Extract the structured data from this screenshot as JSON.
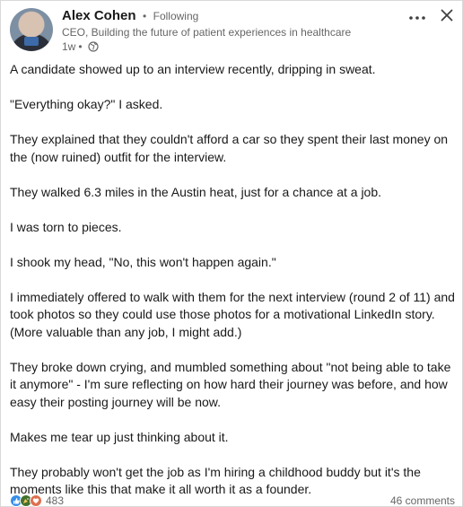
{
  "author": {
    "name": "Alex Cohen",
    "separator": "•",
    "follow_status": "Following",
    "headline": "CEO, Building the future of patient experiences in healthcare",
    "time_ago": "1w",
    "time_separator": "•",
    "visibility_icon": "globe-icon"
  },
  "controls": {
    "more_icon": "more-horizontal-icon",
    "close_icon": "close-icon"
  },
  "post": {
    "paragraphs": [
      "A candidate showed up to an interview recently, dripping in sweat.",
      "\"Everything okay?\" I asked.",
      "They explained that they couldn't afford a car so they spent their last money on the (now ruined) outfit for the interview.",
      "They walked 6.3 miles in the Austin heat, just for a chance at a job.",
      "I was torn to pieces.",
      "I shook my head, \"No, this won't happen again.\"",
      "I immediately offered to walk with them for the next interview (round 2 of 11) and took photos so they could use those photos for a motivational LinkedIn story. (More valuable than any job, I might add.)",
      "They broke down crying, and mumbled something about \"not being able to take it anymore\" - I'm sure reflecting on how hard their journey was before, and how easy their posting journey will be now.",
      "Makes me tear up just thinking about it.",
      "They probably won't get the job as I'm hiring a childhood buddy but it's the moments like this that make it all worth it as a founder."
    ]
  },
  "social": {
    "reaction_icons": [
      "like-icon",
      "celebrate-icon",
      "love-icon"
    ],
    "reaction_count": "483",
    "comments": "46 comments"
  },
  "colors": {
    "like": "#378fe9",
    "celebrate": "#44712e",
    "love": "#df704d",
    "secondary_text": "#666666"
  }
}
